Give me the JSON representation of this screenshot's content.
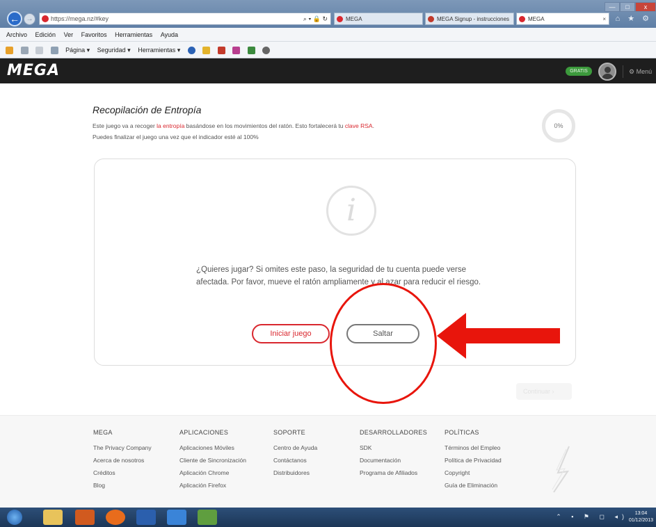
{
  "browser": {
    "address": "https://mega.nz/#key",
    "addr_controls": "⌕ ▾ 🔒 ↻",
    "tabs": [
      {
        "label": "MEGA"
      },
      {
        "label": "MEGA Signup - instrucciones"
      },
      {
        "label": "MEGA"
      }
    ],
    "menu": [
      "Archivo",
      "Edición",
      "Ver",
      "Favoritos",
      "Herramientas",
      "Ayuda"
    ],
    "command": [
      "Página ▾",
      "Seguridad ▾",
      "Herramientas ▾"
    ],
    "win_minimize": "—",
    "win_maximize": "□",
    "win_close": "x",
    "right_icons": "⌂ ★ ⚙"
  },
  "header": {
    "logo": "MEGA",
    "badge": "GRATIS",
    "menu_label": "⚙ Menú"
  },
  "main": {
    "title": "Recopilación de Entropía",
    "desc_prefix": "Este juego va a recoger ",
    "desc_link1": "la entropía",
    "desc_middle": " basándose en los movimientos del ratón. Esto fortalecerá tu ",
    "desc_link2": "clave RSA",
    "desc_suffix": ".",
    "desc_line2": "Puedes finalizar el juego una vez que el indicador esté al 100%",
    "progress_text": "0%",
    "progress_value": 0,
    "info_glyph": "i",
    "prompt": "¿Quieres jugar? Si omites este paso, la seguridad de tu cuenta puede verse afectada. Por favor, mueve el ratón ampliamente y al azar para reducir el riesgo.",
    "start_button": "Iniciar juego",
    "skip_button": "Saltar",
    "continue_button": "Continuar ›"
  },
  "footer": {
    "columns": [
      {
        "heading": "MEGA",
        "items": [
          "The Privacy Company",
          "Acerca de nosotros",
          "Créditos",
          "Blog"
        ]
      },
      {
        "heading": "APLICACIONES",
        "items": [
          "Aplicaciones Móviles",
          "Cliente de Sincronización",
          "Aplicación Chrome",
          "Aplicación Firefox"
        ]
      },
      {
        "heading": "SOPORTE",
        "items": [
          "Centro de Ayuda",
          "Contáctanos",
          "Distribuidores"
        ]
      },
      {
        "heading": "DESARROLLADORES",
        "items": [
          "SDK",
          "Documentación",
          "Programa de Afiliados"
        ]
      },
      {
        "heading": "POLÍTICAS",
        "items": [
          "Términos del Empleo",
          "Política de Privacidad",
          "Copyright",
          "Guía de Eliminación"
        ]
      }
    ]
  },
  "taskbar": {
    "tray": "⌃ ▪ ⚑ ◻ ◂)",
    "clock_time": "13:04",
    "clock_date": "01/12/2013"
  },
  "colors": {
    "brand_red": "#d9272e",
    "annotation_red": "#e8150c",
    "badge_green": "#3c9a3c"
  }
}
